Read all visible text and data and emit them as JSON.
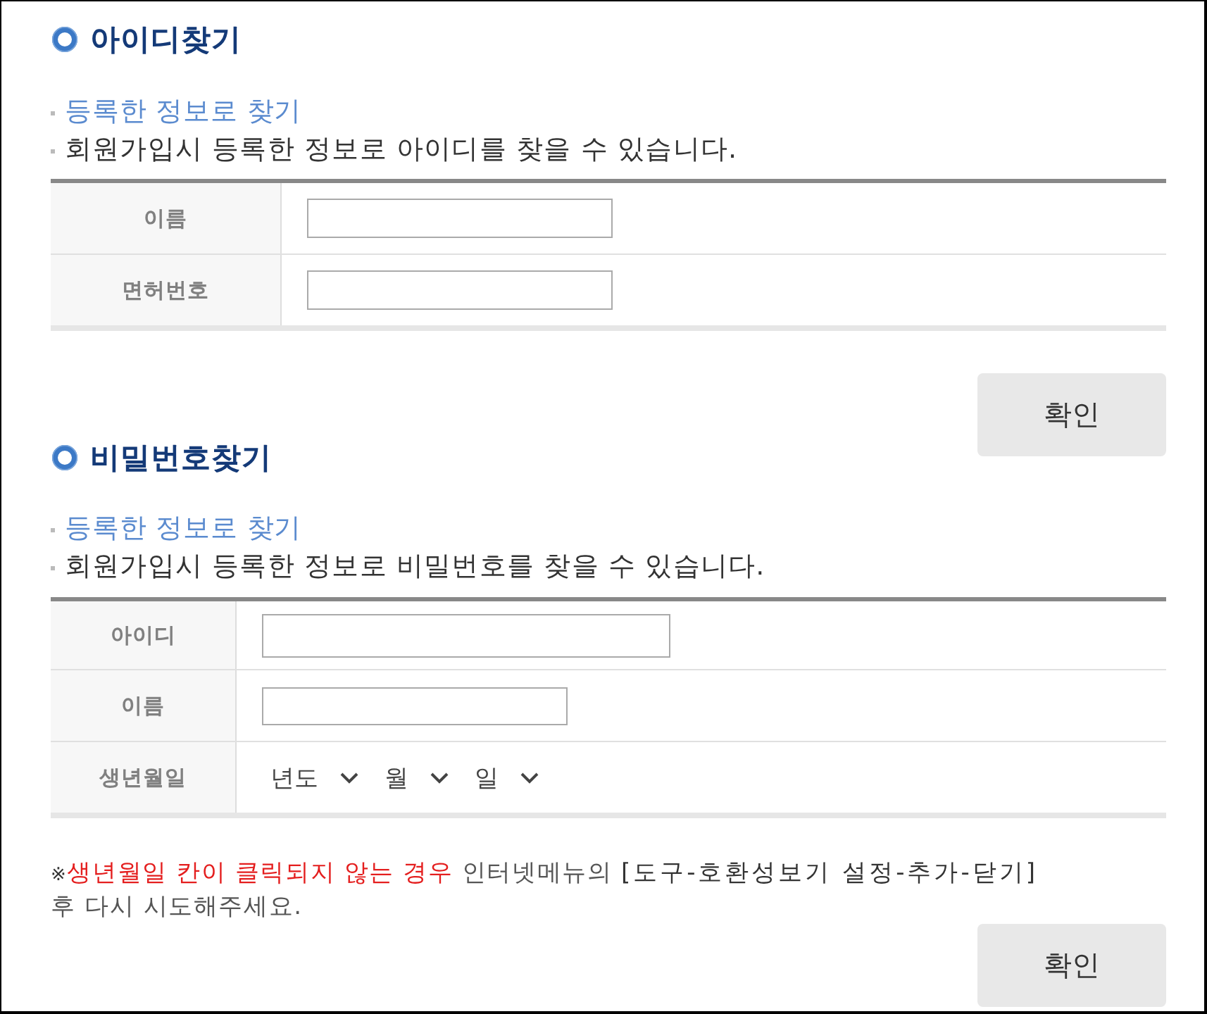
{
  "sections": [
    {
      "title": "아이디찾기",
      "subtitle": "등록한 정보로 찾기",
      "description": "회원가입시 등록한 정보로 아이디를 찾을 수 있습니다.",
      "rows": [
        {
          "label": "이름",
          "kind": "text"
        },
        {
          "label": "면허번호",
          "kind": "text"
        }
      ],
      "button": "확인"
    },
    {
      "title": "비밀번호찾기",
      "subtitle": "등록한 정보로 찾기",
      "description": "회원가입시 등록한 정보로 비밀번호를 찾을 수 있습니다.",
      "rows": [
        {
          "label": "아이디",
          "kind": "text"
        },
        {
          "label": "이름",
          "kind": "text"
        },
        {
          "label": "생년월일",
          "kind": "date",
          "selects": [
            "년도",
            "월",
            "일"
          ]
        }
      ],
      "note": {
        "mark": "※",
        "highlight": "생년월일 칸이 클릭되지 않는 경우",
        "text": "인터넷메뉴의",
        "path": "[도구-호환성보기 설정-추가-닫기]",
        "end": "후 다시 시도해주세요."
      },
      "button": "확인"
    }
  ]
}
